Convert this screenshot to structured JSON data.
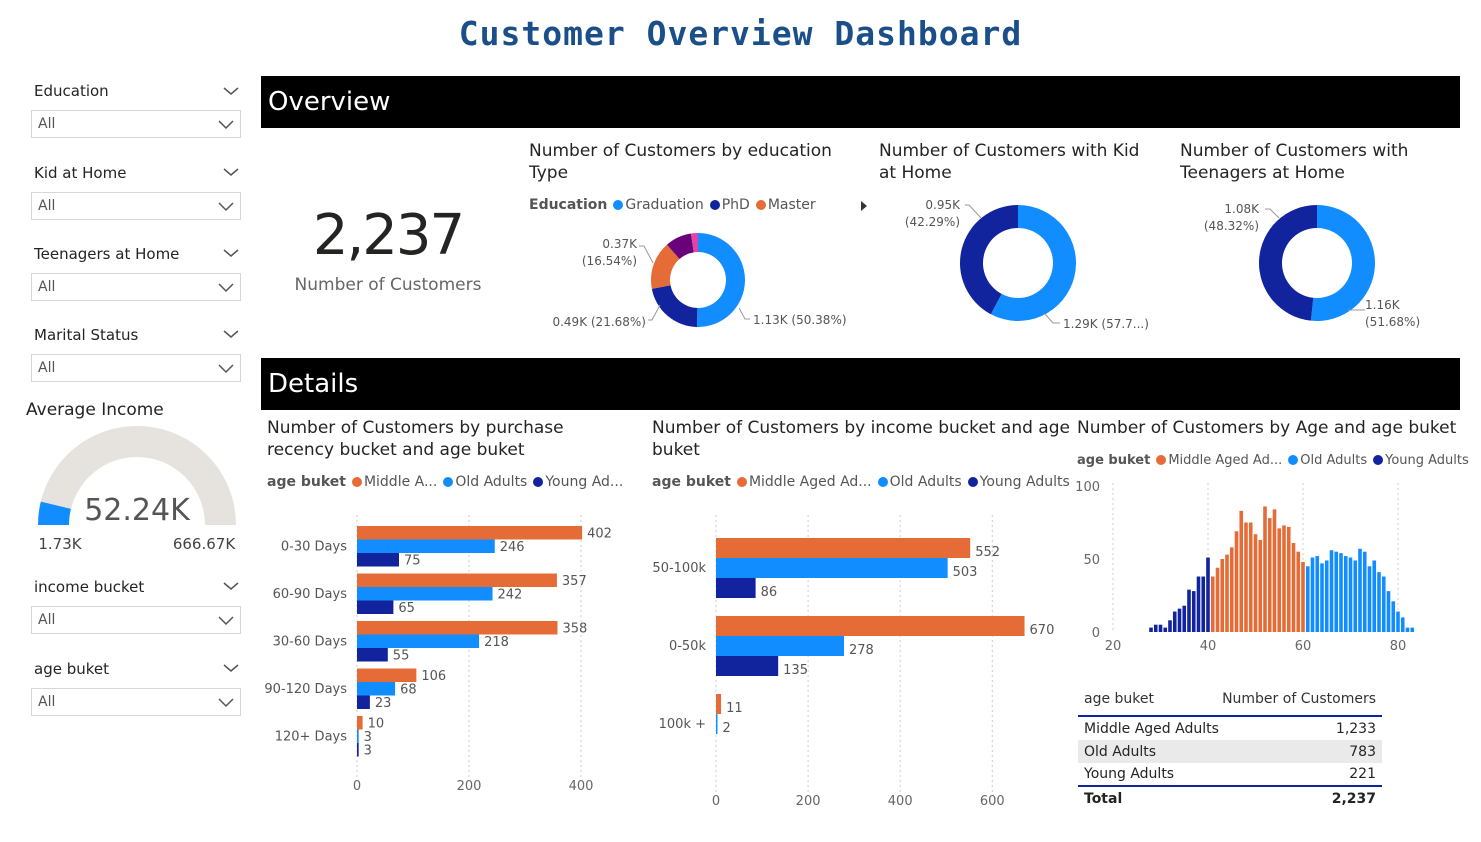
{
  "dashboard_title": "Customer Overview Dashboard",
  "slicers": [
    {
      "label": "Education",
      "value": "All"
    },
    {
      "label": "Kid at Home",
      "value": "All"
    },
    {
      "label": "Teenagers at Home",
      "value": "All"
    },
    {
      "label": "Marital Status",
      "value": "All"
    },
    {
      "label": "income bucket",
      "value": "All"
    },
    {
      "label": "age buket",
      "value": "All"
    }
  ],
  "gauge": {
    "title": "Average Income",
    "value_label": "52.24K",
    "min_label": "1.73K",
    "max_label": "666.67K",
    "fill_fraction": 0.076
  },
  "sections": {
    "overview": "Overview",
    "details": "Details"
  },
  "kpi": {
    "value": "2,237",
    "label": "Number of Customers"
  },
  "colors": {
    "orange": "#e66c37",
    "blue": "#118dff",
    "navy": "#12239e",
    "purple": "#6b007b",
    "magenta": "#e044a7",
    "grey": "#e6e3df"
  },
  "chart_data": [
    {
      "type": "pie",
      "title_line1": "Number of Customers by education",
      "title_line2": "Type",
      "legend_title": "Education",
      "legend": [
        "Graduation",
        "PhD",
        "Master"
      ],
      "slices": [
        {
          "name": "Graduation",
          "value": 1127,
          "label": "1.13K (50.38%)",
          "color": "#118dff"
        },
        {
          "name": "PhD",
          "value": 485,
          "label": "0.49K (21.68%)",
          "color": "#12239e"
        },
        {
          "name": "Master",
          "value": 370,
          "label": "0.37K",
          "label2": "(16.54%)",
          "color": "#e66c37"
        },
        {
          "name": "",
          "value": 203,
          "color": "#6b007b"
        },
        {
          "name": "",
          "value": 54,
          "color": "#e044a7"
        }
      ]
    },
    {
      "type": "pie",
      "title_line1": "Number of Customers with Kid",
      "title_line2": "at Home",
      "slices": [
        {
          "value": 1293,
          "label": "1.29K (57.7...)",
          "color": "#118dff"
        },
        {
          "value": 946,
          "label": "0.95K",
          "label2": "(42.29%)",
          "color": "#12239e"
        }
      ]
    },
    {
      "type": "pie",
      "title_line1": "Number of Customers with",
      "title_line2": "Teenagers at Home",
      "slices": [
        {
          "value": 1156,
          "label": "1.16K",
          "label2": "(51.68%)",
          "color": "#118dff"
        },
        {
          "value": 1081,
          "label": "1.08K",
          "label2": "(48.32%)",
          "color": "#12239e"
        }
      ]
    },
    {
      "type": "bar",
      "title_line1": "Number of Customers by purchase",
      "title_line2": "recency bucket and age buket",
      "legend_title": "age buket",
      "legend": [
        "Middle A...",
        "Old Adults",
        "Young Ad..."
      ],
      "categories": [
        "0-30 Days",
        "60-90 Days",
        "30-60 Days",
        "90-120 Days",
        "120+ Days"
      ],
      "series": [
        {
          "name": "Middle Aged Adults",
          "values": [
            402,
            357,
            358,
            106,
            10
          ]
        },
        {
          "name": "Old Adults",
          "values": [
            246,
            242,
            218,
            68,
            3
          ]
        },
        {
          "name": "Young Adults",
          "values": [
            75,
            65,
            55,
            23,
            3
          ]
        }
      ],
      "xlim": [
        0,
        400
      ],
      "xticks": [
        "0",
        "200",
        "400"
      ]
    },
    {
      "type": "bar",
      "title_line1": "Number of Customers by income bucket and age",
      "title_line2": "buket",
      "legend_title": "age buket",
      "legend": [
        "Middle Aged Ad...",
        "Old Adults",
        "Young Adults"
      ],
      "categories": [
        "50-100k",
        "0-50k",
        "100k +"
      ],
      "series": [
        {
          "name": "Middle Aged Adults",
          "values": [
            552,
            670,
            11
          ]
        },
        {
          "name": "Old Adults",
          "values": [
            503,
            278,
            2
          ]
        },
        {
          "name": "Young Adults",
          "values": [
            86,
            135,
            0
          ]
        }
      ],
      "xlim": [
        0,
        600
      ],
      "xticks": [
        "0",
        "200",
        "400",
        "600"
      ]
    },
    {
      "type": "bar",
      "title_line1": "Number of Customers by Age and age buket",
      "legend_title": "age buket",
      "legend": [
        "Middle Aged Ad...",
        "Old Adults",
        "Young Adults"
      ],
      "x_start": 28,
      "young_values": [
        3,
        5,
        5,
        3,
        8,
        14,
        16,
        18,
        29,
        28,
        38,
        38,
        51
      ],
      "middle_values": [
        38,
        44,
        50,
        53,
        58,
        69,
        83,
        75,
        75,
        67,
        63,
        86,
        78,
        84,
        71,
        73,
        72,
        61,
        55,
        48
      ],
      "old_values": [
        45,
        51,
        52,
        47,
        49,
        56,
        55,
        54,
        52,
        51,
        49,
        57,
        55,
        45,
        49,
        41,
        38,
        28,
        21,
        14,
        10,
        3,
        3
      ],
      "xlim": [
        20,
        85
      ],
      "ylim": [
        0,
        100
      ],
      "xticks": [
        "20",
        "40",
        "60",
        "80"
      ],
      "yticks": [
        "0",
        "50",
        "100"
      ]
    }
  ],
  "age_table": {
    "headers": [
      "age buket",
      "Number of Customers"
    ],
    "rows": [
      {
        "label": "Middle Aged Adults",
        "value": "1,233"
      },
      {
        "label": "Old Adults",
        "value": "783"
      },
      {
        "label": "Young Adults",
        "value": "221"
      }
    ],
    "total": {
      "label": "Total",
      "value": "2,237"
    }
  }
}
